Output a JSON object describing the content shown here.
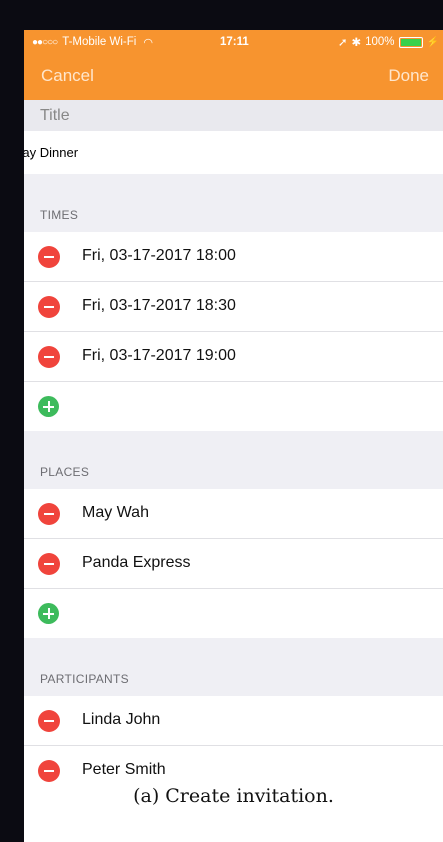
{
  "status_bar": {
    "signal": "●●○○○",
    "carrier": "T-Mobile Wi-Fi",
    "time": "17:11",
    "battery": "100%"
  },
  "nav": {
    "cancel": "Cancel",
    "done": "Done"
  },
  "title_field": {
    "label": "Title",
    "value": "Friday Dinner"
  },
  "sections": {
    "times": {
      "header": "TIMES",
      "items": [
        "Fri, 03-17-2017 18:00",
        "Fri, 03-17-2017 18:30",
        "Fri, 03-17-2017 19:00"
      ]
    },
    "places": {
      "header": "PLACES",
      "items": [
        "May Wah",
        "Panda Express"
      ]
    },
    "participants": {
      "header": "PARTICIPANTS",
      "items": [
        "Linda John",
        "Peter Smith"
      ]
    }
  },
  "caption": "(a) Create invitation.",
  "colors": {
    "accent": "#f7942f",
    "remove": "#f0443c",
    "add": "#3dbb5c"
  },
  "icons": [
    "wifi-icon",
    "location-arrow-icon",
    "bluetooth-icon",
    "battery-icon",
    "remove-icon",
    "add-icon"
  ]
}
